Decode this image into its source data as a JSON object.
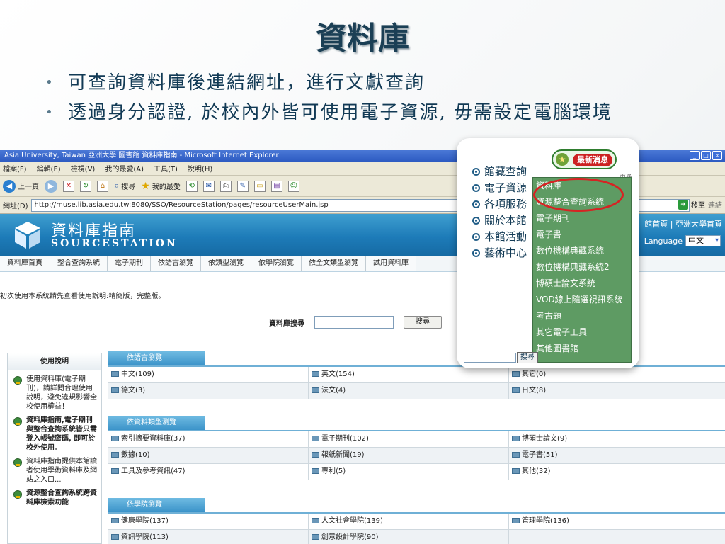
{
  "slide": {
    "title": "資料庫",
    "bullets": [
      "可查詢資料庫後連結網址，進行文獻查詢",
      "透過身分認證, 於校內外皆可使用電子資源, 毋需設定電腦環境"
    ]
  },
  "browser": {
    "window_title": "Asia University, Taiwan 亞洲大學 圖書館 資料庫指南 - Microsoft Internet Explorer",
    "menu": [
      "檔案(F)",
      "編輯(E)",
      "檢視(V)",
      "我的最愛(A)",
      "工具(T)",
      "說明(H)"
    ],
    "toolbar": {
      "back": "上一頁",
      "search": "搜尋",
      "favorites": "我的最愛"
    },
    "address": {
      "label": "網址(D)",
      "url": "http://muse.lib.asia.edu.tw:8080/SSO/ResourceStation/pages/resourceUserMain.jsp",
      "go": "移至",
      "links": "連結"
    }
  },
  "site": {
    "title": "資料庫指南",
    "subtitle": "SOURCESTATION",
    "top_links": "館首頁 | 亞洲大學首頁",
    "language_label": "Language",
    "language_value": "中文",
    "tabs": [
      "資料庫首頁",
      "整合查詢系統",
      "電子期刊",
      "依語言瀏覽",
      "依類型瀏覽",
      "依學院瀏覽",
      "依全文類型瀏覽",
      "試用資料庫"
    ],
    "notice": "初次使用本系統請先查看使用說明:精簡版，完整版。",
    "search": {
      "label": "資料庫搜尋",
      "button": "搜尋"
    },
    "help": {
      "header": "使用說明",
      "items": [
        "使用資料庫(電子期刊)，請詳閱合理使用說明，避免違規影響全校使用權益！",
        "資料庫指南,電子期刊與整合查詢系統皆只需登入帳號密碼, 即可於校外使用。",
        "資料庫指南提供本館讀者使用學術資料庫及網站之入口...",
        "資源整合查詢系統跨資料庫檢索功能"
      ]
    },
    "sections": [
      {
        "title": "依語言瀏覽",
        "rows": [
          [
            "中文(109)",
            "英文(154)",
            "其它(0)"
          ],
          [
            "德文(3)",
            "法文(4)",
            "日文(8)"
          ]
        ]
      },
      {
        "title": "依資料類型瀏覽",
        "rows": [
          [
            "索引摘要資料庫(37)",
            "電子期刊(102)",
            "博碩士論文(9)"
          ],
          [
            "數據(10)",
            "報紙新聞(19)",
            "電子書(51)"
          ],
          [
            "工具及參考資訊(47)",
            "專利(5)",
            "其他(32)"
          ]
        ]
      },
      {
        "title": "依學院瀏覽",
        "rows": [
          [
            "健康學院(137)",
            "人文社會學院(139)",
            "管理學院(136)"
          ],
          [
            "資訊學院(113)",
            "創意設計學院(90)",
            ""
          ]
        ]
      }
    ]
  },
  "zoom_popup": {
    "news_button": "最新消息",
    "more": "更多",
    "menu": [
      "館藏查詢",
      "電子資源",
      "各項服務",
      "關於本館",
      "本館活動",
      "藝術中心"
    ],
    "submenu": [
      "資料庫",
      "資源整合查詢系統",
      "電子期刊",
      "電子書",
      "數位機構典藏系統",
      "數位機構典藏系統2",
      "博碩士論文系統",
      "VOD線上隨選視訊系統",
      "考古題",
      "其它電子工具",
      "其他圖書館"
    ],
    "search_button": "搜尋"
  }
}
